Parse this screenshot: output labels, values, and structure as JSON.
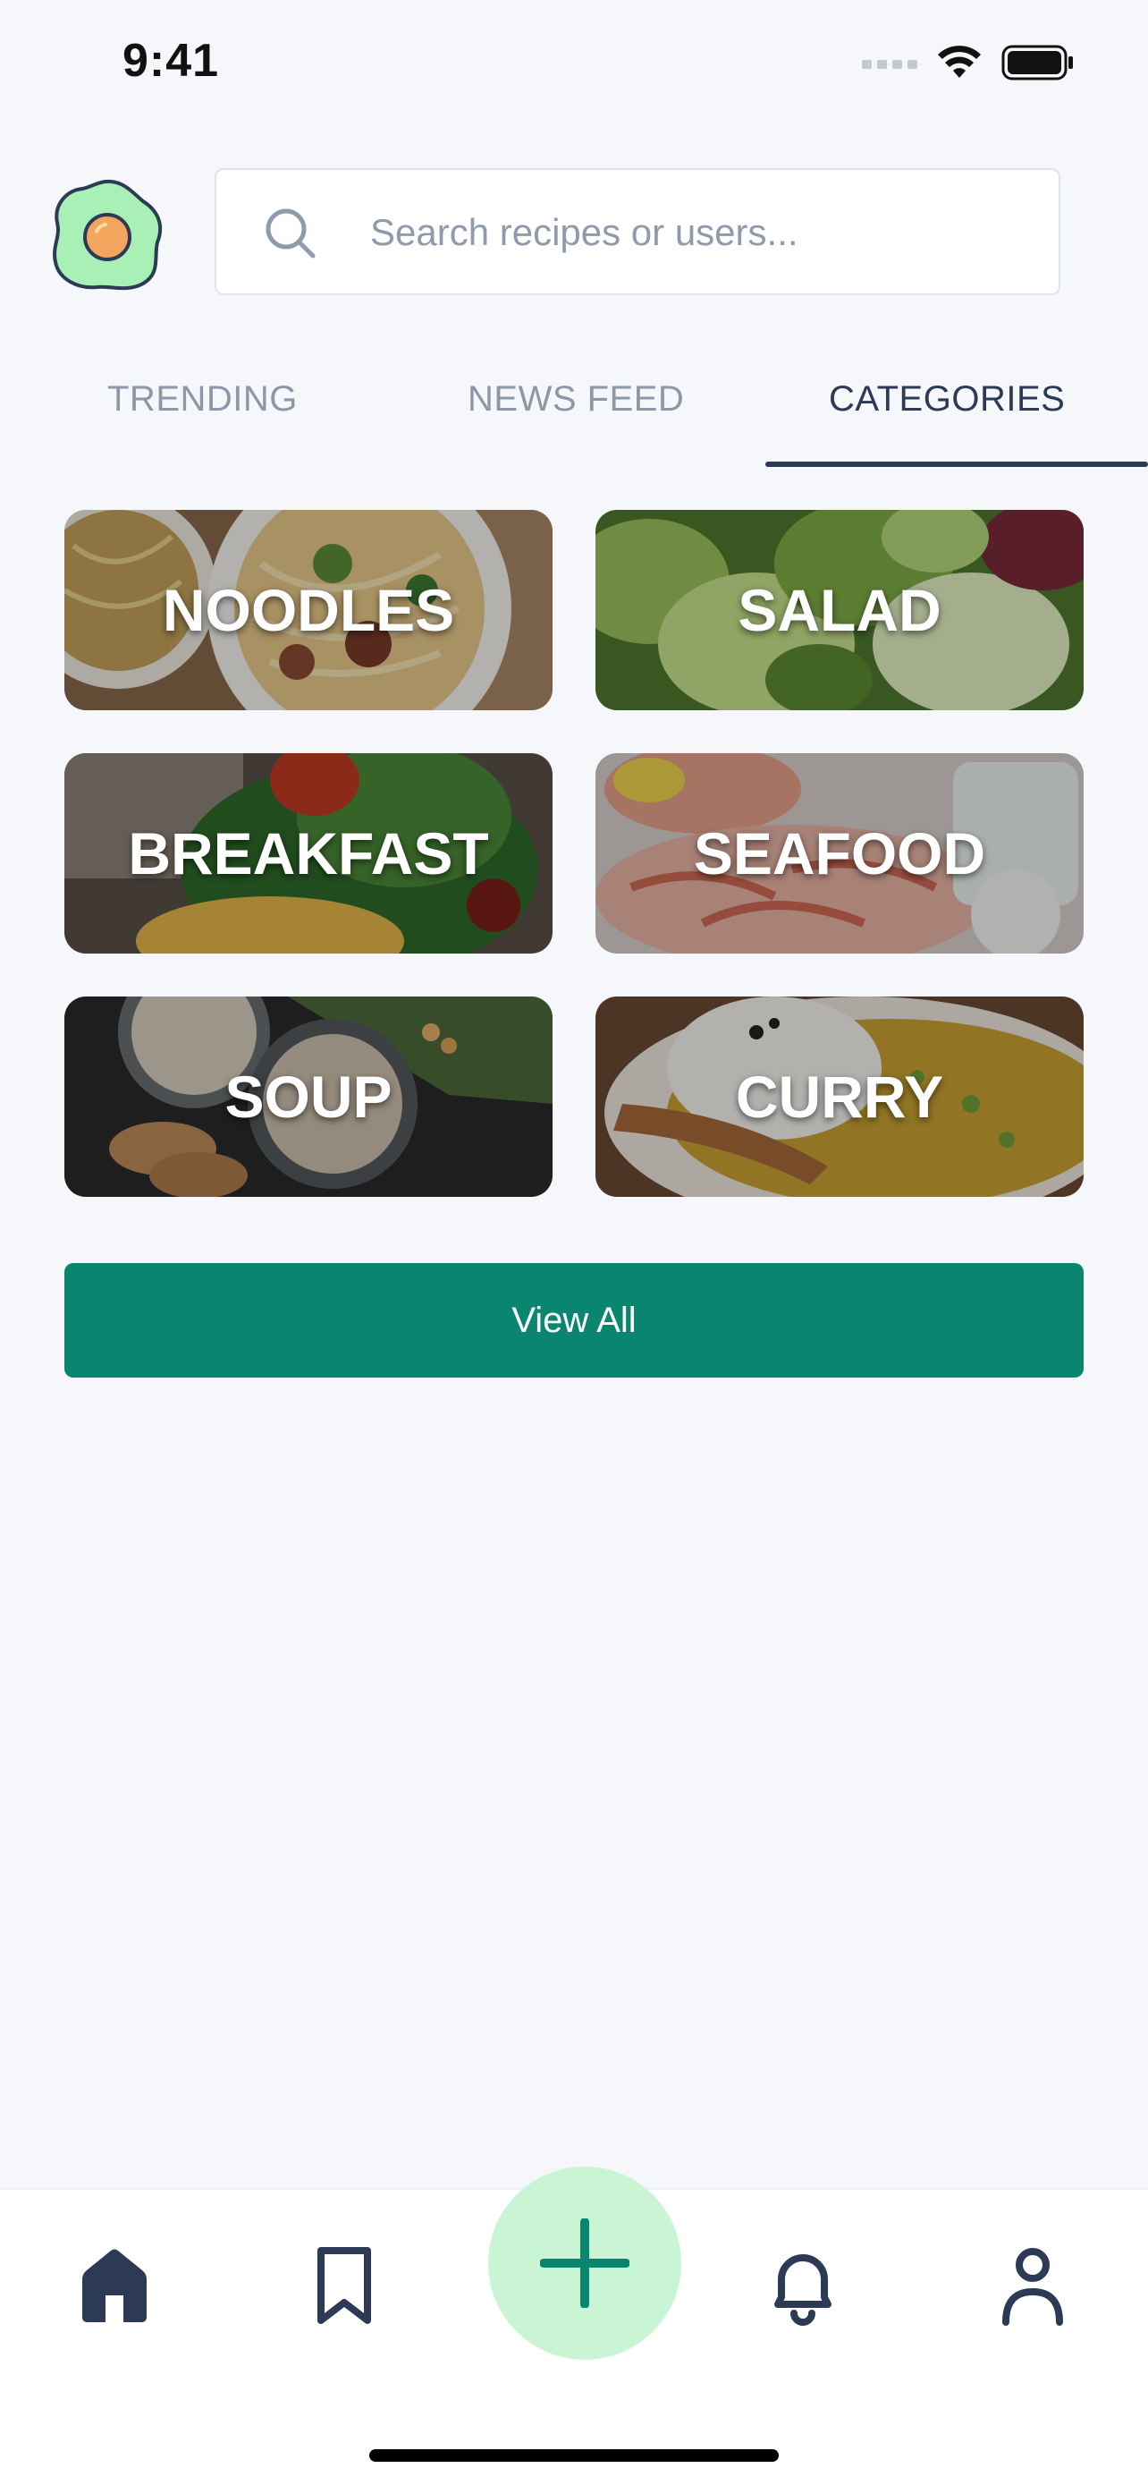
{
  "status_bar": {
    "time": "9:41",
    "icons": [
      "signal-icon",
      "wifi-icon",
      "battery-icon"
    ]
  },
  "header": {
    "logo": "egg-logo",
    "search": {
      "placeholder": "Search recipes or users...",
      "value": "",
      "icon": "search-icon"
    }
  },
  "tabs": [
    {
      "label": "TRENDING",
      "active": false
    },
    {
      "label": "NEWS FEED",
      "active": false
    },
    {
      "label": "CATEGORIES",
      "active": true
    }
  ],
  "categories": [
    {
      "label": "NOODLES"
    },
    {
      "label": "SALAD"
    },
    {
      "label": "BREAKFAST"
    },
    {
      "label": "SEAFOOD"
    },
    {
      "label": "SOUP"
    },
    {
      "label": "CURRY"
    }
  ],
  "view_all_label": "View All",
  "bottom_nav": {
    "items": [
      {
        "icon": "home-icon",
        "active": true
      },
      {
        "icon": "bookmark-icon",
        "active": false
      },
      {
        "icon": "plus-icon",
        "active": false
      },
      {
        "icon": "bell-icon",
        "active": false
      },
      {
        "icon": "profile-icon",
        "active": false
      }
    ]
  },
  "colors": {
    "background": "#f6f7fb",
    "accent": "#0a8670",
    "fab": "#c9f5d4",
    "tab_active": "#2d3a55",
    "tab_inactive": "#8c97a8"
  }
}
